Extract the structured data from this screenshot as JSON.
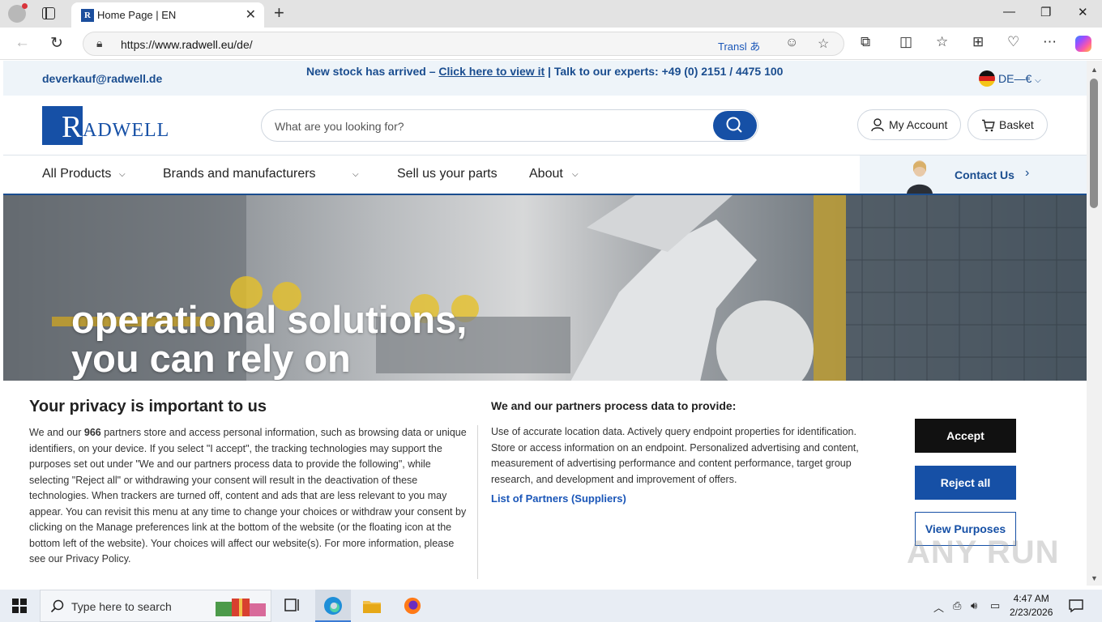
{
  "browser": {
    "tab_title": "Home Page | EN",
    "favicon_letter": "R",
    "url_prefix": "https://",
    "url_host": "www.radwell.eu",
    "url_path": "/de/",
    "translate_label": "Transl",
    "translate_glyph": "あ"
  },
  "topbar": {
    "email": "deverkauf@radwell.de",
    "promo_lead": "New stock has arrived – ",
    "promo_link": "Click here to view it",
    "promo_tail": " | Talk to our experts: +49 (0) 2151 / 4475 100",
    "lang_label": "DE—€"
  },
  "header": {
    "logo_initial": "R",
    "logo_text": "ADWELL",
    "search_placeholder": "What are you looking for?",
    "account_label": "My Account",
    "basket_label": "Basket"
  },
  "menu": {
    "all_products": "All Products",
    "brands": "Brands and manufacturers",
    "sell": "Sell us your parts",
    "about": "About",
    "contact": "Contact Us"
  },
  "hero": {
    "line1": "operational solutions,",
    "line2": "you can rely on"
  },
  "privacy": {
    "title": "Your privacy is important to us",
    "body_pre": "We and our ",
    "partner_count": "966",
    "body_post": " partners store and access personal information, such as browsing data or unique identifiers, on your device. If you select \"I accept\", the tracking technologies may support the purposes set out under \"We and our partners process data to provide the following\", while selecting \"Reject all\" or withdrawing your consent will result in the deactivation of these technologies. When trackers are turned off, content and ads that are less relevant to you may appear. You can revisit this menu at any time to change your choices or withdraw your consent by clicking on the Manage preferences link at the bottom of the website (or the floating icon at the bottom left of the website). Your choices will affect our website(s). For more information, please see our Privacy Policy.",
    "purposes_title": "We and our partners process data to provide:",
    "purposes_body": "Use of accurate location data. Actively query endpoint properties for identification. Store or access information on an endpoint. Personalized advertising and content, measurement of advertising performance and content performance, target group research, and development and improvement of offers.",
    "partners_link": "List of Partners (Suppliers)",
    "accept": "Accept",
    "reject": "Reject all",
    "view_purposes": "View Purposes",
    "watermark": "ANY RUN"
  },
  "taskbar": {
    "search_label": "Type here to search",
    "time": "4:47 AM",
    "date": "2/23/2026"
  },
  "colors": {
    "brand_blue": "#1650a6",
    "link_blue": "#1a4d8f",
    "button_black": "#111111"
  }
}
